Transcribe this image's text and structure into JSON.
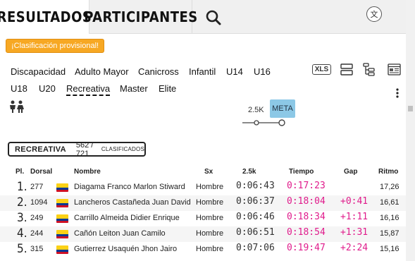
{
  "tabs": {
    "resultados": "RESULTADOS",
    "participantes": "PARTICIPANTES"
  },
  "translate_label": "文",
  "provisional": "¡Clasificación provisional!",
  "categories": [
    "Discapacidad",
    "Adulto Mayor",
    "Canicross",
    "Infantil",
    "U14",
    "U16",
    "U18",
    "U20",
    "Recreativa",
    "Master",
    "Elite"
  ],
  "active_category": "Recreativa",
  "tools": {
    "xls": "XLS"
  },
  "checkpoints": [
    "2.5K",
    "META"
  ],
  "summary": {
    "category": "RECREATIVA",
    "count": "562 / 721",
    "suffix": "CLASIFICADOS"
  },
  "table": {
    "headers": [
      "Pl.",
      "Dorsal",
      "Nombre",
      "Sx",
      "2.5k",
      "Tiempo",
      "Gap",
      "Ritmo"
    ],
    "rows": [
      {
        "pl": "1.",
        "dorsal": "277",
        "nombre": "Diagama Franco Marlon Stiward",
        "sx": "Hombre",
        "t25": "0:06:43",
        "tiempo": "0:17:23",
        "gap": "",
        "ritmo": "17,26"
      },
      {
        "pl": "2.",
        "dorsal": "1094",
        "nombre": "Lancheros Castañeda Juan David",
        "sx": "Hombre",
        "t25": "0:06:37",
        "tiempo": "0:18:04",
        "gap": "+0:41",
        "ritmo": "16,61"
      },
      {
        "pl": "3.",
        "dorsal": "249",
        "nombre": "Carrillo Almeida Didier Enrique",
        "sx": "Hombre",
        "t25": "0:06:46",
        "tiempo": "0:18:34",
        "gap": "+1:11",
        "ritmo": "16,16"
      },
      {
        "pl": "4.",
        "dorsal": "244",
        "nombre": "Cañón Leiton Juan Camilo",
        "sx": "Hombre",
        "t25": "0:06:51",
        "tiempo": "0:18:54",
        "gap": "+1:31",
        "ritmo": "15,87"
      },
      {
        "pl": "5.",
        "dorsal": "315",
        "nombre": "Gutierrez Usaquén Jhon Jairo",
        "sx": "Hombre",
        "t25": "0:07:06",
        "tiempo": "0:19:47",
        "gap": "+2:24",
        "ritmo": "15,16"
      }
    ]
  },
  "colors": {
    "accent": "#e01c8c",
    "provisional_bg": "#f7a823",
    "meta_bg": "#8cc8e6"
  }
}
